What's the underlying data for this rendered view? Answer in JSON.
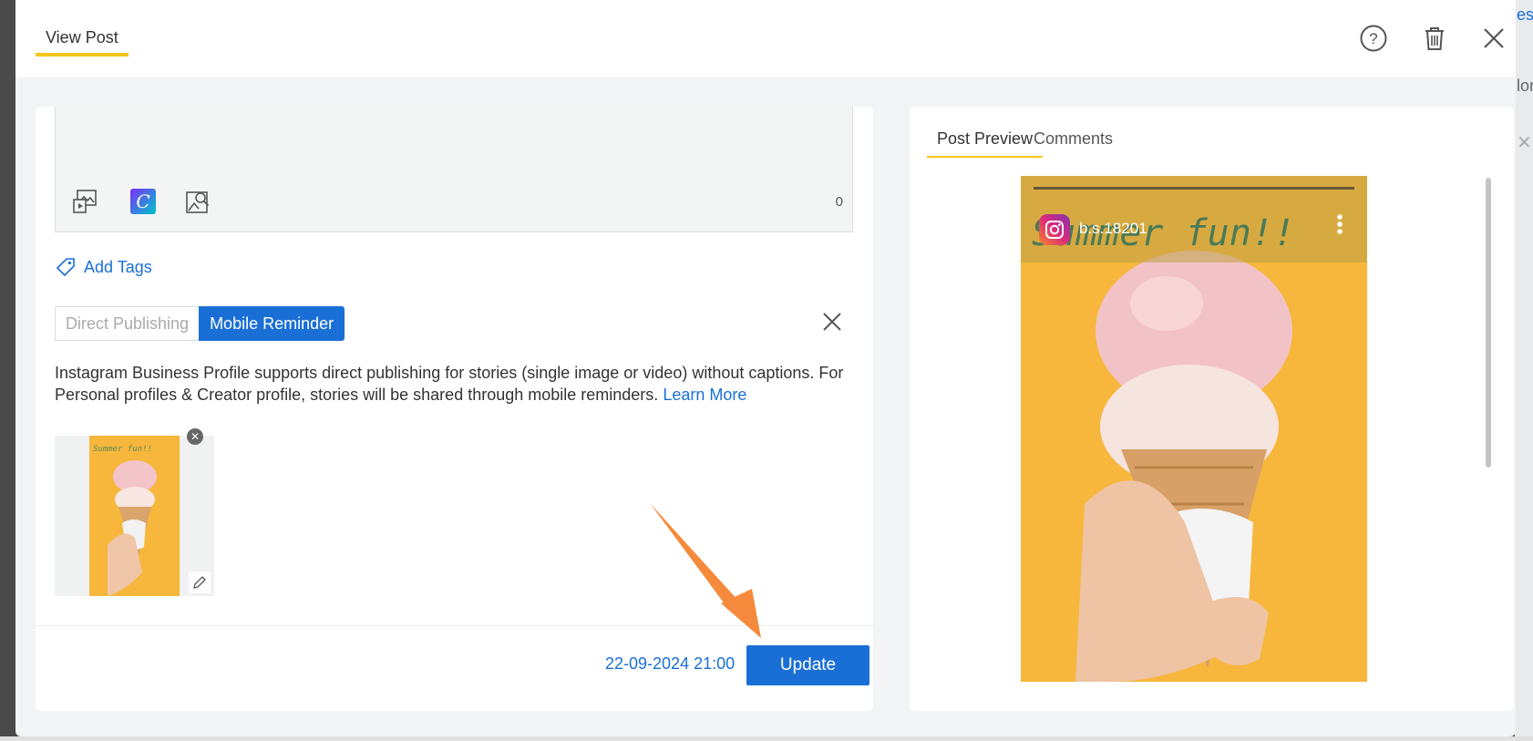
{
  "header": {
    "tab_label": "View Post",
    "icons": [
      "help-icon",
      "trash-icon",
      "close-icon"
    ]
  },
  "background_page": {
    "text_top": "est",
    "text_mid": "lor"
  },
  "editor": {
    "tools": [
      "media-library-icon",
      "canva-icon",
      "image-search-icon"
    ],
    "canva_letter": "C",
    "char_count": "0"
  },
  "add_tags_label": "Add Tags",
  "publishing_mode": {
    "options": [
      "Direct Publishing",
      "Mobile Reminder"
    ],
    "selected": "Mobile Reminder"
  },
  "info": {
    "text": "Instagram Business Profile supports direct publishing for stories (single image or video) without captions. For Personal profiles & Creator profile, stories will be shared through mobile reminders.",
    "link": "Learn More"
  },
  "media": {
    "caption_in_image": "Summer fun!!"
  },
  "footer": {
    "schedule": "22-09-2024 21:00",
    "update_label": "Update"
  },
  "preview": {
    "tabs": [
      "Post Preview",
      "Comments"
    ],
    "active_tab": "Post Preview",
    "username": "b.s.18201",
    "story_text": "Summer fun!!"
  },
  "colors": {
    "accent": "#1a6fd6",
    "tab_underline": "#f5c518",
    "story_bg": "#f6b73c",
    "annotation_arrow": "#f58a3c"
  }
}
